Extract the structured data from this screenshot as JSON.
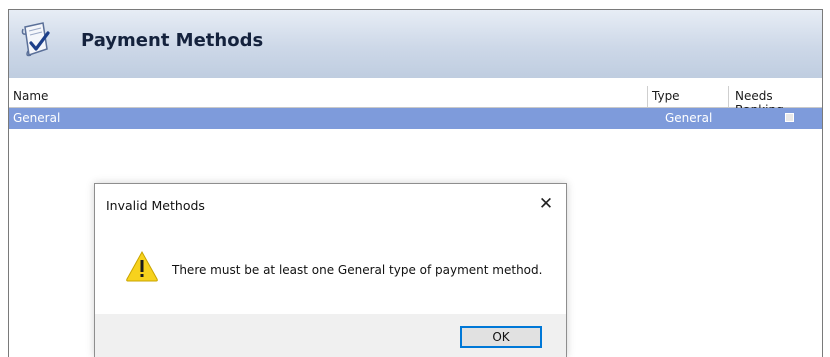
{
  "header": {
    "title": "Payment Methods",
    "icon": "document-check-icon"
  },
  "grid": {
    "columns": [
      "Name",
      "Type",
      "Needs Banking"
    ],
    "rows": [
      {
        "name": "General",
        "type": "General",
        "needs_banking": false
      }
    ],
    "selected_row_color": "#7e9bdb"
  },
  "dialog": {
    "title": "Invalid Methods",
    "message": "There must be at least one General type of payment method.",
    "ok_label": "OK",
    "close_glyph": "✕",
    "icon": "warning-icon"
  }
}
